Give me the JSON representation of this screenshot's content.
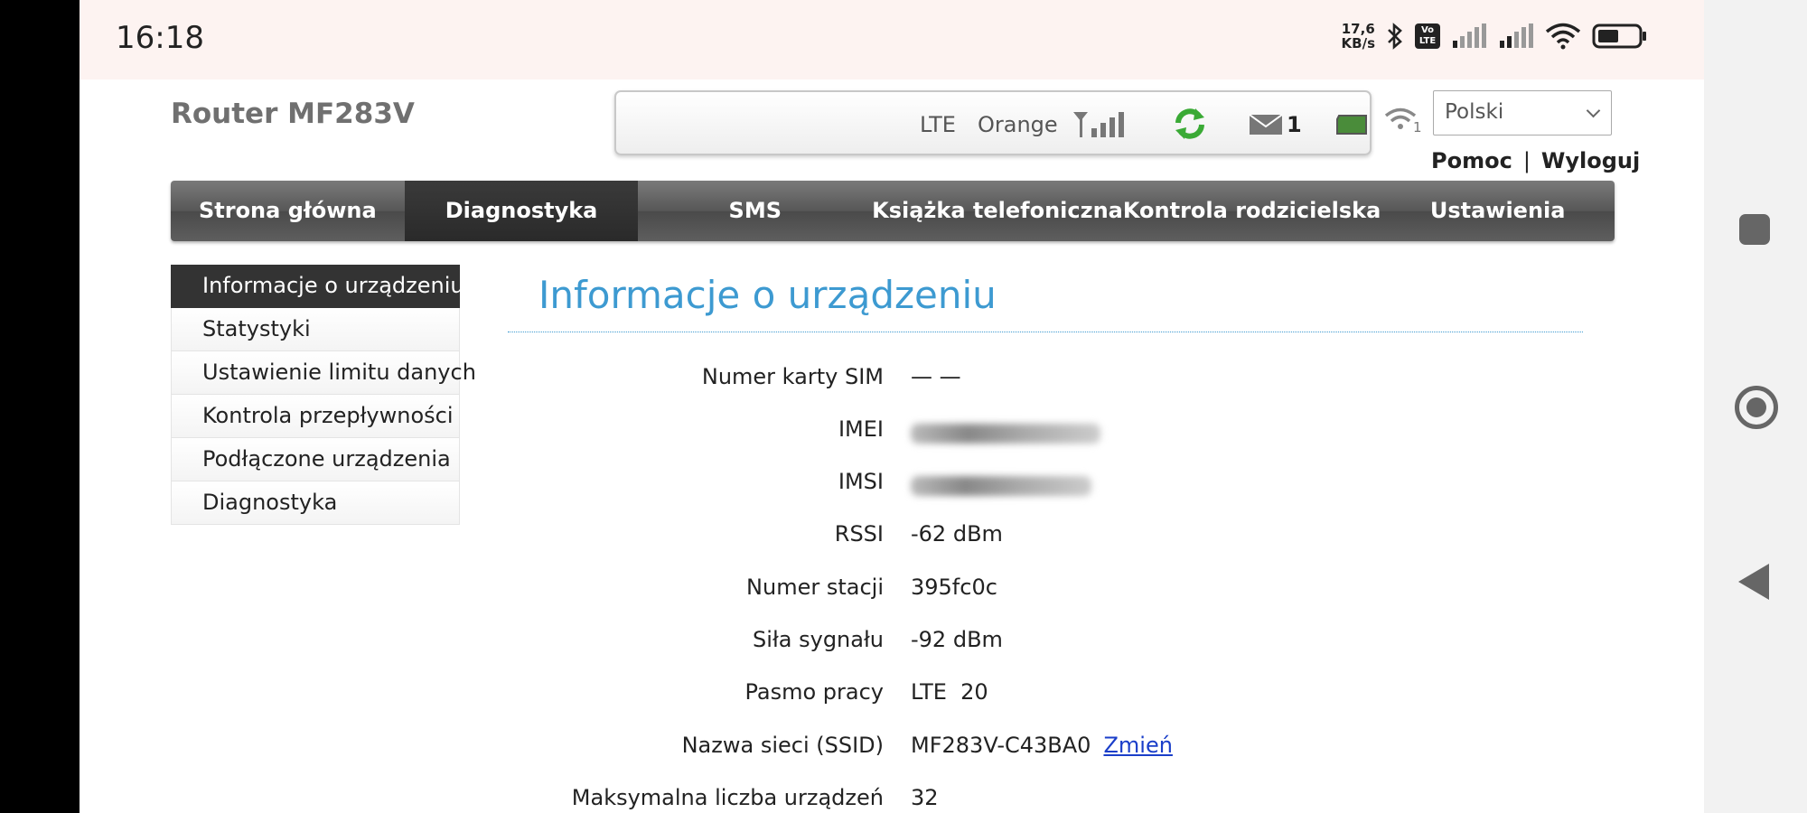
{
  "statusbar": {
    "time": "16:18",
    "speed_value": "17,6",
    "speed_unit": "KB/s",
    "volte_top": "Vo",
    "volte_bottom": "LTE",
    "icons": [
      "bluetooth-icon",
      "signal-icon",
      "signal-icon",
      "wifi-icon",
      "battery-icon"
    ]
  },
  "header": {
    "title": "Router MF283V",
    "network_type": "LTE",
    "operator": "Orange",
    "sms_count": "1",
    "wifi_clients": "1",
    "language": "Polski",
    "help": "Pomoc",
    "separator": "|",
    "logout": "Wyloguj"
  },
  "mainnav": [
    {
      "label": "Strona główna"
    },
    {
      "label": "Diagnostyka",
      "active": true
    },
    {
      "label": "SMS"
    },
    {
      "label": "Książka telefoniczna"
    },
    {
      "label": "Kontrola rodzicielska"
    },
    {
      "label": "Ustawienia"
    }
  ],
  "sidebar": [
    {
      "label": "Informacje o urządzeniu",
      "active": true
    },
    {
      "label": "Statystyki"
    },
    {
      "label": "Ustawienie limitu danych"
    },
    {
      "label": "Kontrola przepływności"
    },
    {
      "label": "Podłączone urządzenia"
    },
    {
      "label": "Diagnostyka"
    }
  ],
  "main": {
    "title": "Informacje o urządzeniu",
    "rows": [
      {
        "label": "Numer karty SIM",
        "value": "— —"
      },
      {
        "label": "IMEI",
        "value": ""
      },
      {
        "label": "IMSI",
        "value": ""
      },
      {
        "label": "RSSI",
        "value": "-62 dBm"
      },
      {
        "label": "Numer stacji",
        "value": "395fc0c"
      },
      {
        "label": "Siła sygnału",
        "value": "-92 dBm"
      },
      {
        "label": "Pasmo pracy",
        "value": "LTE  20"
      },
      {
        "label": "Nazwa sieci (SSID)",
        "value": "MF283V-C43BA0",
        "link": "Zmień"
      },
      {
        "label": "Maksymalna liczba urządzeń",
        "value": "32"
      }
    ]
  },
  "colors": {
    "accent": "#3d9ad1",
    "link": "#1a3ec9",
    "nav_bg": "#575757",
    "nav_active": "#2a2a2a",
    "status_green": "#3aaa35"
  }
}
